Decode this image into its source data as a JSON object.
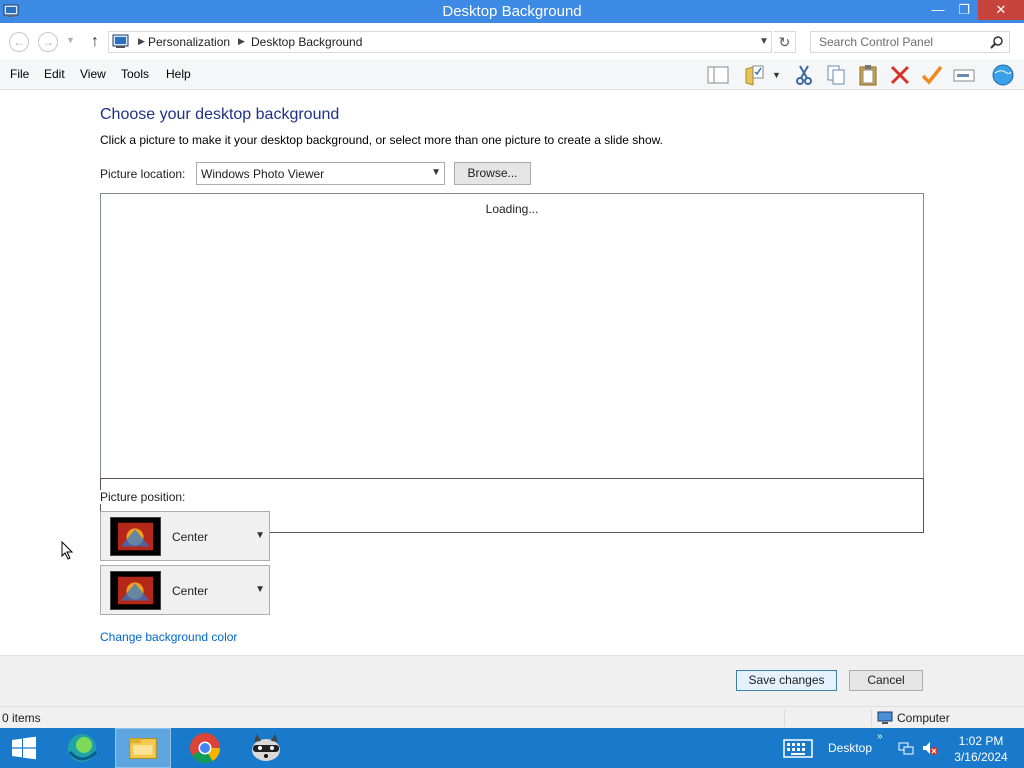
{
  "window": {
    "title": "Desktop Background",
    "minimize_glyph": "—",
    "maximize_glyph": "❐",
    "close_glyph": "✕"
  },
  "address": {
    "crumbs": [
      "Personalization",
      "Desktop Background"
    ],
    "search_placeholder": "Search Control Panel"
  },
  "menu": {
    "items": [
      "File",
      "Edit",
      "View",
      "Tools",
      "Help"
    ]
  },
  "toolbar_icons": [
    "layout-pane-icon",
    "folder-checklist-icon",
    "cut-icon",
    "copy-icon",
    "paste-icon",
    "delete-icon",
    "properties-check-icon",
    "rename-icon",
    "globe-icon"
  ],
  "content": {
    "heading": "Choose your desktop background",
    "description": "Click a picture to make it your desktop background, or select more than one picture to create a slide show.",
    "picture_location_label": "Picture location:",
    "picture_location_value": "Windows Photo Viewer",
    "browse_label": "Browse...",
    "loading_text": "Loading...",
    "picture_position_label": "Picture position:",
    "position_dropdowns": [
      {
        "value": "Center"
      },
      {
        "value": "Center"
      }
    ],
    "change_bg_color_link": "Change background color"
  },
  "footer": {
    "save_label": "Save changes",
    "cancel_label": "Cancel"
  },
  "status": {
    "items_count": "0 items",
    "location": "Computer"
  },
  "taskbar": {
    "apps": [
      "edge-icon",
      "file-explorer-icon",
      "chrome-icon",
      "raccoon-app-icon"
    ],
    "desktop_label": "Desktop",
    "overflow_glyph": "»",
    "time": "1:02 PM",
    "date": "3/16/2024"
  },
  "colors": {
    "titlebar": "#3c8ae4",
    "taskbar": "#1979ca",
    "heading": "#1e3287",
    "link": "#0066cc"
  }
}
